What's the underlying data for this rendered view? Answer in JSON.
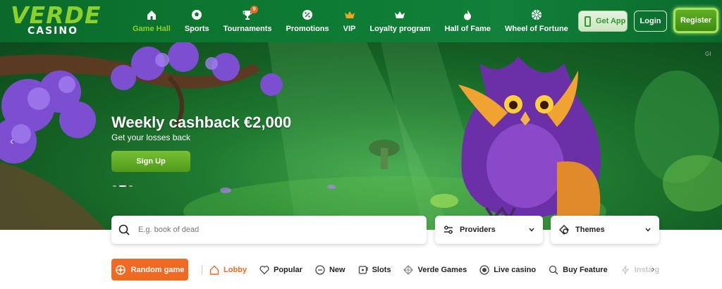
{
  "logo": {
    "top": "VERDE",
    "bottom": "CASINO"
  },
  "nav": {
    "items": [
      {
        "label": "Game Hall",
        "icon": "home-icon"
      },
      {
        "label": "Sports",
        "icon": "soccer-ball-icon"
      },
      {
        "label": "Tournaments",
        "icon": "trophy-icon",
        "badge": "9"
      },
      {
        "label": "Promotions",
        "icon": "promotion-icon"
      },
      {
        "label": "VIP",
        "icon": "crown-icon"
      },
      {
        "label": "Loyalty program",
        "icon": "loyalty-crown-icon"
      },
      {
        "label": "Hall of Fame",
        "icon": "fire-icon"
      },
      {
        "label": "Wheel of Fortune",
        "icon": "wheel-icon"
      }
    ]
  },
  "header_buttons": {
    "get_app": "Get App",
    "login": "Login",
    "register": "Register"
  },
  "hero": {
    "title": "Weekly cashback €2,000",
    "subtitle": "Get your losses back",
    "cta": "Sign Up",
    "corner_text": "GI"
  },
  "search": {
    "placeholder": "E.g. book of dead"
  },
  "filters": {
    "providers": "Providers",
    "themes": "Themes"
  },
  "random_game": "Random game",
  "categories": [
    {
      "label": "Lobby",
      "icon": "lobby-home-icon"
    },
    {
      "label": "Popular",
      "icon": "heart-icon"
    },
    {
      "label": "New",
      "icon": "new-icon"
    },
    {
      "label": "Slots",
      "icon": "slots-icon"
    },
    {
      "label": "Verde Games",
      "icon": "verde-games-icon"
    },
    {
      "label": "Live casino",
      "icon": "live-casino-icon"
    },
    {
      "label": "Buy Feature",
      "icon": "buy-feature-icon"
    },
    {
      "label": "Insta g",
      "icon": "insta-games-icon"
    }
  ],
  "colors": {
    "header_green": "#0d7a32",
    "accent_lime": "#8cd12a",
    "accent_orange": "#f06a24"
  }
}
